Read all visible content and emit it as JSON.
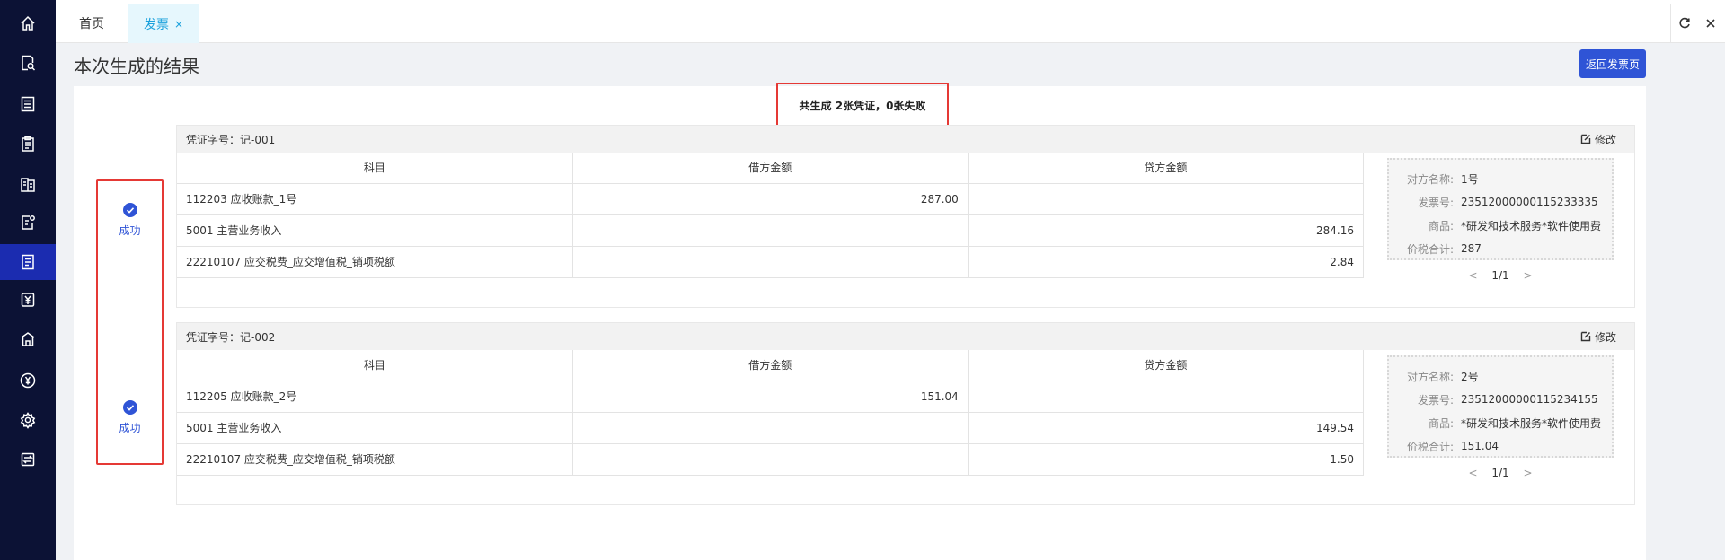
{
  "sidebar": {
    "icons": [
      "home-icon",
      "search-doc-icon",
      "list-icon",
      "clipboard-icon",
      "ledger-icon",
      "doc-edit-icon",
      "invoice-icon",
      "yen-icon",
      "bank-icon",
      "yen-circle-icon",
      "gear-icon",
      "exchange-icon"
    ],
    "active_index": 6
  },
  "tabs": {
    "home_label": "首页",
    "invoice_label": "发票",
    "close_glyph": "×"
  },
  "page": {
    "title": "本次生成的结果",
    "back_button": "返回发票页",
    "summary": "共生成 2张凭证，0张失败"
  },
  "colors": {
    "sidebar_bg": "#0c1235",
    "accent": "#2f54d6",
    "highlight_border": "#e53935"
  },
  "vouchers": [
    {
      "status": "成功",
      "voucher_no": "凭证字号：记-001",
      "edit_label": "修改",
      "headers": [
        "科目",
        "借方金额",
        "贷方金额"
      ],
      "rows": [
        [
          "112203 应收账款_1号",
          "287.00",
          ""
        ],
        [
          "5001 主营业务收入",
          "",
          "284.16"
        ],
        [
          "22210107 应交税费_应交增值税_销项税额",
          "",
          "2.84"
        ]
      ],
      "invoice": {
        "counterparty_label": "对方名称:",
        "counterparty": "1号",
        "invoice_no_label": "发票号:",
        "invoice_no": "23512000000115233335",
        "goods_label": "商品:",
        "goods": "*研发和技术服务*软件使用费",
        "total_label": "价税合计:",
        "total": "287"
      },
      "pager": {
        "prev": "<",
        "page": "1/1",
        "next": ">"
      }
    },
    {
      "status": "成功",
      "voucher_no": "凭证字号：记-002",
      "edit_label": "修改",
      "headers": [
        "科目",
        "借方金额",
        "贷方金额"
      ],
      "rows": [
        [
          "112205 应收账款_2号",
          "151.04",
          ""
        ],
        [
          "5001 主营业务收入",
          "",
          "149.54"
        ],
        [
          "22210107 应交税费_应交增值税_销项税额",
          "",
          "1.50"
        ]
      ],
      "invoice": {
        "counterparty_label": "对方名称:",
        "counterparty": "2号",
        "invoice_no_label": "发票号:",
        "invoice_no": "23512000000115234155",
        "goods_label": "商品:",
        "goods": "*研发和技术服务*软件使用费",
        "total_label": "价税合计:",
        "total": "151.04"
      },
      "pager": {
        "prev": "<",
        "page": "1/1",
        "next": ">"
      }
    }
  ]
}
